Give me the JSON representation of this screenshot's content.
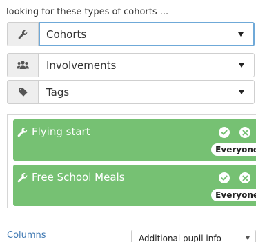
{
  "filters": {
    "intro_text": "looking for these types of cohorts ...",
    "selects": [
      {
        "value": "Cohorts",
        "icon": "wrench-icon"
      },
      {
        "value": "Involvements",
        "icon": "users-icon"
      },
      {
        "value": "Tags",
        "icon": "tag-icon"
      }
    ]
  },
  "selected_cohorts": [
    {
      "name": "Flying start",
      "badge": "Everyone"
    },
    {
      "name": "Free School Meals",
      "badge": "Everyone"
    }
  ],
  "columns": {
    "label": "Columns",
    "selected": "Additional pupil info"
  },
  "colors": {
    "cohort_green": "#76c173",
    "focus_border": "#6fa9d8",
    "link_blue": "#3e78b2"
  }
}
